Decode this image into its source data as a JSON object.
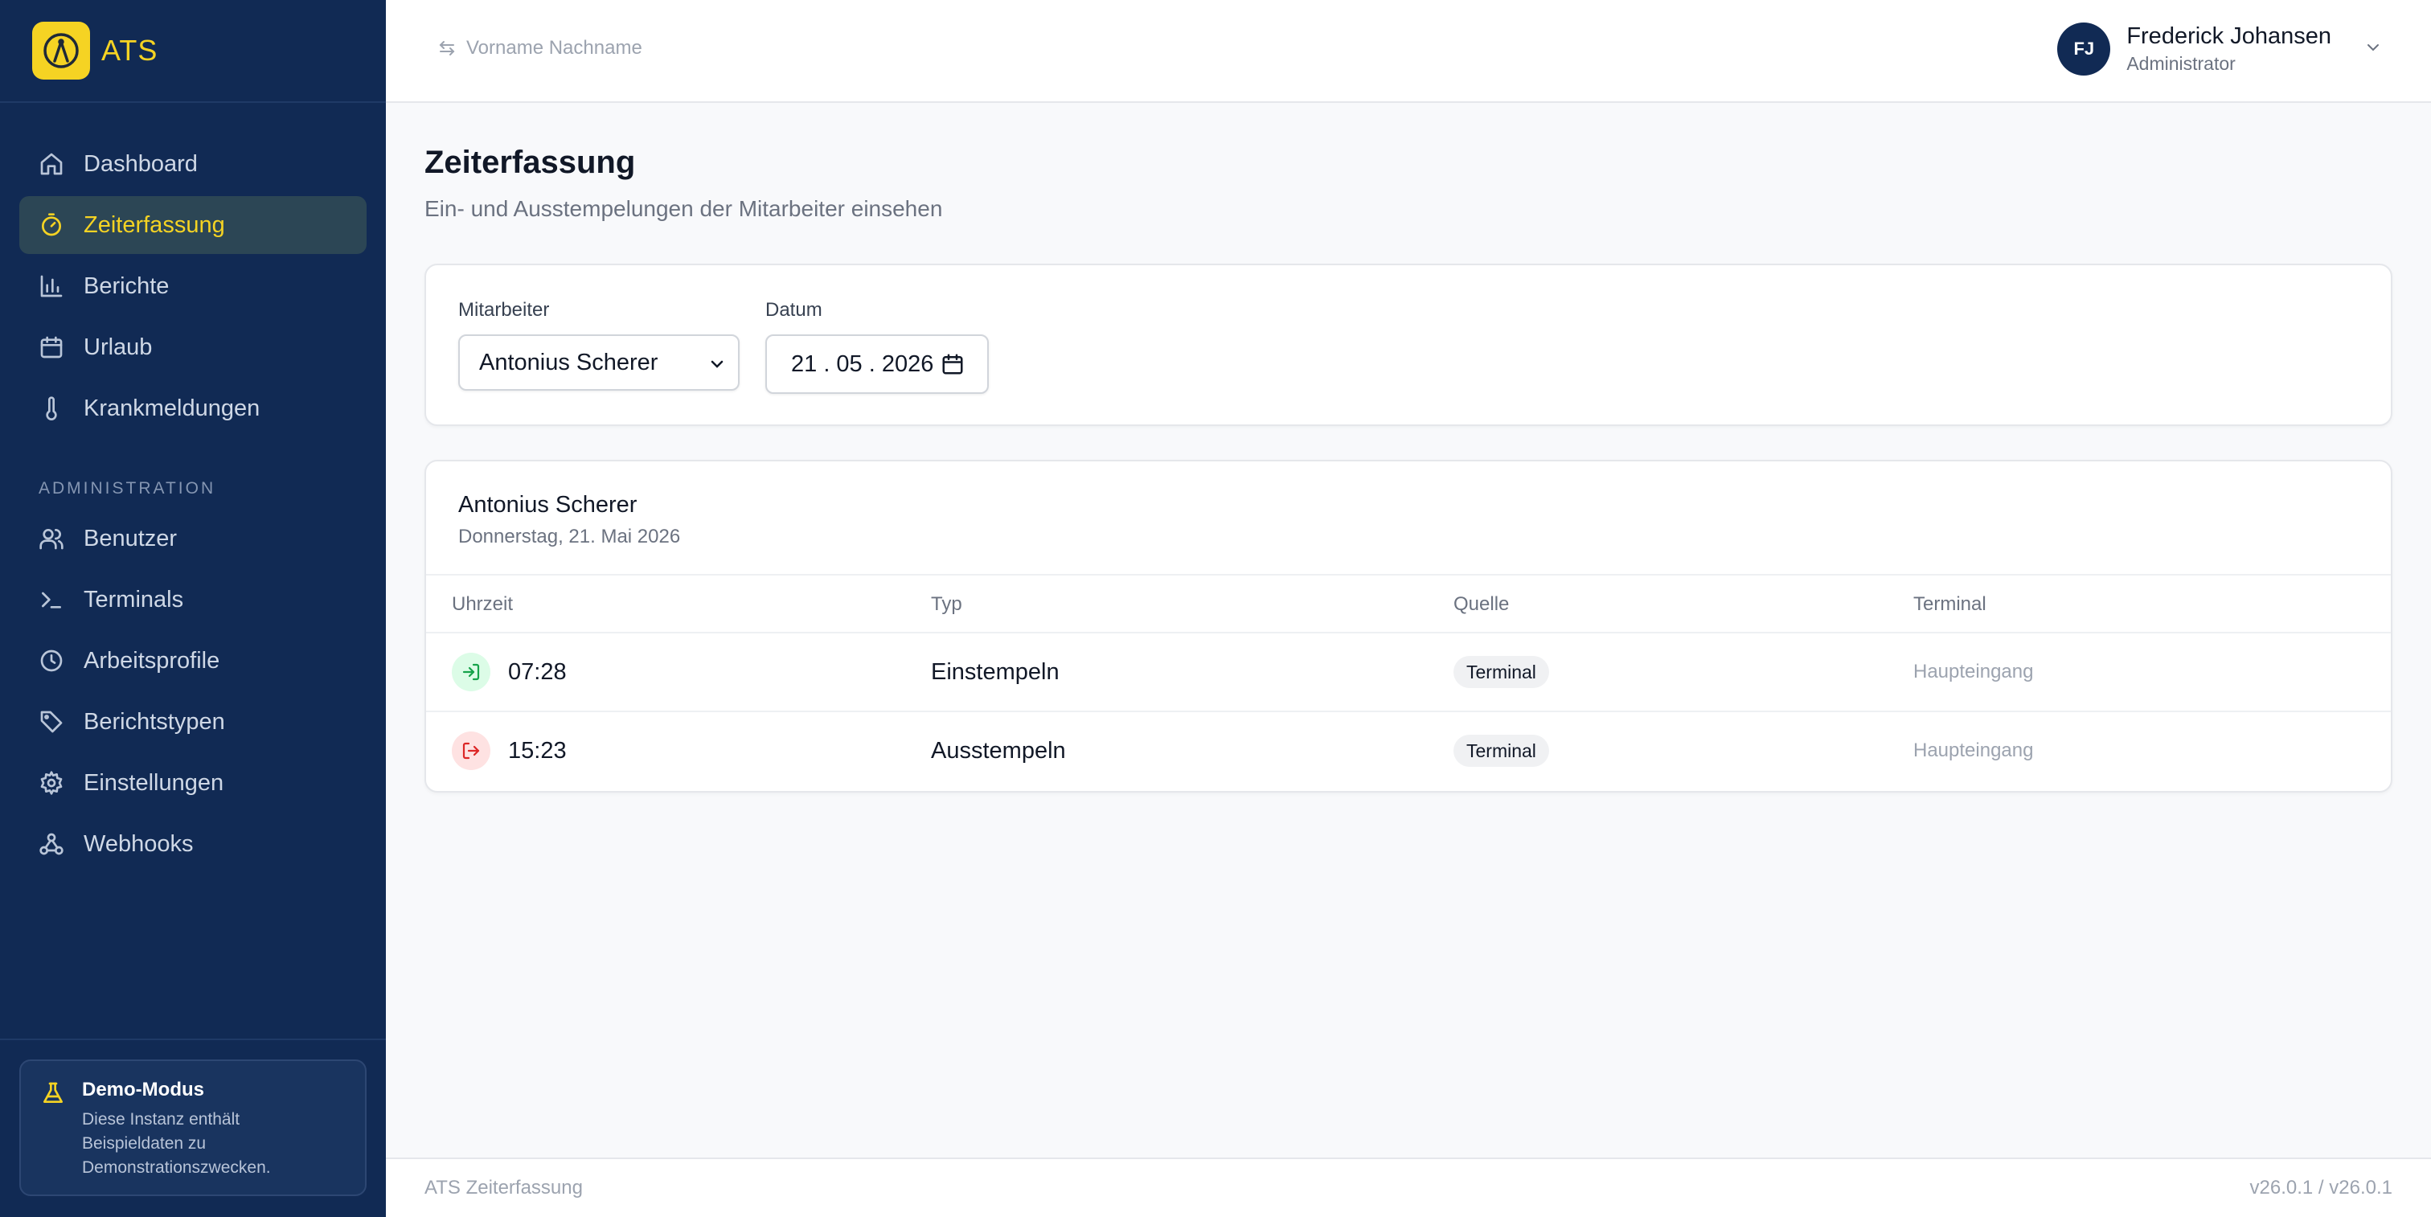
{
  "brand": {
    "name": "ATS"
  },
  "sidebar": {
    "items": [
      {
        "label": "Dashboard",
        "icon": "home-icon"
      },
      {
        "label": "Zeiterfassung",
        "icon": "stopwatch-icon",
        "active": true
      },
      {
        "label": "Berichte",
        "icon": "bar-chart-icon"
      },
      {
        "label": "Urlaub",
        "icon": "calendar-icon"
      },
      {
        "label": "Krankmeldungen",
        "icon": "thermometer-icon"
      }
    ],
    "admin_section": "ADMINISTRATION",
    "admin_items": [
      {
        "label": "Benutzer",
        "icon": "users-icon"
      },
      {
        "label": "Terminals",
        "icon": "terminal-icon"
      },
      {
        "label": "Arbeitsprofile",
        "icon": "clock-icon"
      },
      {
        "label": "Berichtstypen",
        "icon": "tag-icon"
      },
      {
        "label": "Einstellungen",
        "icon": "gear-icon"
      },
      {
        "label": "Webhooks",
        "icon": "webhook-icon"
      }
    ],
    "demo": {
      "title": "Demo-Modus",
      "text": "Diese Instanz enthält Beispieldaten zu Demonstrationszwecken."
    }
  },
  "header": {
    "impersonate_placeholder": "Vorname Nachname",
    "user": {
      "initials": "FJ",
      "name": "Frederick Johansen",
      "role": "Administrator"
    }
  },
  "page": {
    "title": "Zeiterfassung",
    "subtitle": "Ein- und Ausstempelungen der Mitarbeiter einsehen"
  },
  "filters": {
    "employee_label": "Mitarbeiter",
    "employee_value": "Antonius Scherer",
    "date_label": "Datum",
    "date_value": "21 . 05 . 2026"
  },
  "result": {
    "employee": "Antonius Scherer",
    "date": "Donnerstag, 21. Mai 2026",
    "columns": [
      "Uhrzeit",
      "Typ",
      "Quelle",
      "Terminal"
    ],
    "rows": [
      {
        "time": "07:28",
        "type": "Einstempeln",
        "source": "Terminal",
        "terminal": "Haupteingang",
        "direction": "in"
      },
      {
        "time": "15:23",
        "type": "Ausstempeln",
        "source": "Terminal",
        "terminal": "Haupteingang",
        "direction": "out"
      }
    ]
  },
  "footer": {
    "left": "ATS Zeiterfassung",
    "right": "v26.0.1 / v26.0.1"
  },
  "colors": {
    "sidebar_bg": "#112a54",
    "accent": "#f5d323",
    "active_bg": "#2c4655"
  }
}
